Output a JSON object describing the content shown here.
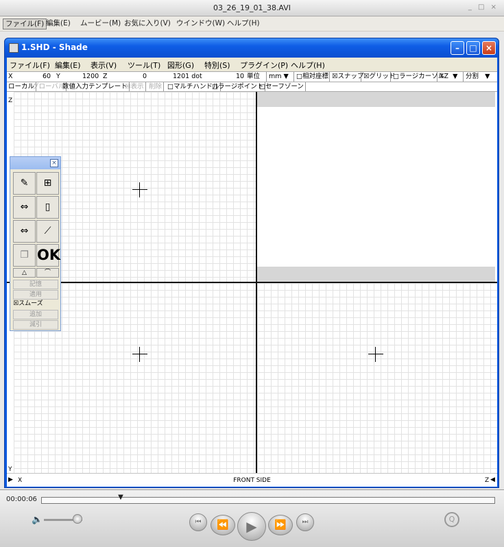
{
  "qt": {
    "title": "03_26_19_01_38.AVI",
    "window_buttons": "_ □ ×",
    "menus": [
      "ファイル(F)",
      "編集(E)",
      "ムービー(M)",
      "お気に入り(V)",
      "ウインドウ(W)",
      "ヘルプ(H)"
    ],
    "timecode": "00:00:06",
    "playhead_fraction": 0.176,
    "volume_fraction": 0.88,
    "icons": [
      "volume-icon",
      "go-to-start-icon",
      "rewind-icon",
      "play-icon",
      "fast-forward-icon",
      "go-to-end-icon",
      "quicktime-logo-icon",
      "apple-icon"
    ]
  },
  "shade": {
    "title": "1.SHD - Shade",
    "menus": [
      "ファイル(F)",
      "編集(E)",
      "表示(V)",
      "ツール(T)",
      "図形(G)",
      "特別(S)",
      "プラグイン(P)",
      "ヘルプ(H)"
    ],
    "info": {
      "x_label": "X",
      "x_value": "60",
      "y_label": "Y",
      "y_value": "1200",
      "z_label": "Z",
      "z_value": "0",
      "dot_value": "1201 dot",
      "unit_num": "10",
      "unit_label": "単位",
      "unit_select": "mm",
      "relative_coords": "□相対座標",
      "snap": "☒スナップ",
      "grid": "☒グリッド",
      "large_cursor": "□ラージカーソル",
      "plane_select": "XZ",
      "split": "分割"
    },
    "options": {
      "local": "ローカル",
      "global": "グローバル",
      "numeric_template": "数値入力テンプレート",
      "show": "☒表示",
      "delete": "削除",
      "multi_handle": "□マルチハンドル",
      "large_point": "□ラージポイント",
      "safe_zone": "□セーフゾーン"
    },
    "viewport": {
      "front_side": "FRONT SIDE",
      "axis_x": "X",
      "axis_y": "Y",
      "axis_z_top": "Z",
      "axis_z_right": "Z"
    },
    "palette": {
      "ok": "OK",
      "memory": "記憶",
      "apply": "適用",
      "smooth": "☒スムーズ",
      "add": "追加",
      "subtract": "減引"
    }
  }
}
